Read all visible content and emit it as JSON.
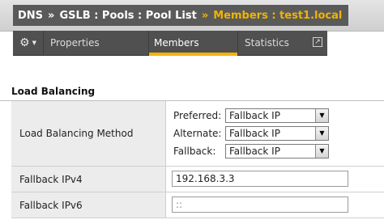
{
  "breadcrumb": {
    "items": [
      "DNS",
      "GSLB : Pools : Pool List"
    ],
    "separator": "»",
    "current": "Members : test1.local"
  },
  "tabs": [
    {
      "label": "Properties"
    },
    {
      "label": "Members",
      "active": true
    },
    {
      "label": "Statistics"
    }
  ],
  "section": {
    "title": "Load Balancing"
  },
  "rows": {
    "method": {
      "label": "Load Balancing Method",
      "selects": [
        {
          "label": "Preferred:",
          "value": "Fallback IP"
        },
        {
          "label": "Alternate:",
          "value": "Fallback IP"
        },
        {
          "label": "Fallback:",
          "value": "Fallback IP"
        }
      ]
    },
    "ipv4": {
      "label": "Fallback IPv4",
      "value": "192.168.3.3"
    },
    "ipv6": {
      "label": "Fallback IPv6",
      "value": "::"
    }
  },
  "colors": {
    "accent": "#f0b400",
    "tabbar": "#505050",
    "crumb": "#5a5a5a"
  }
}
